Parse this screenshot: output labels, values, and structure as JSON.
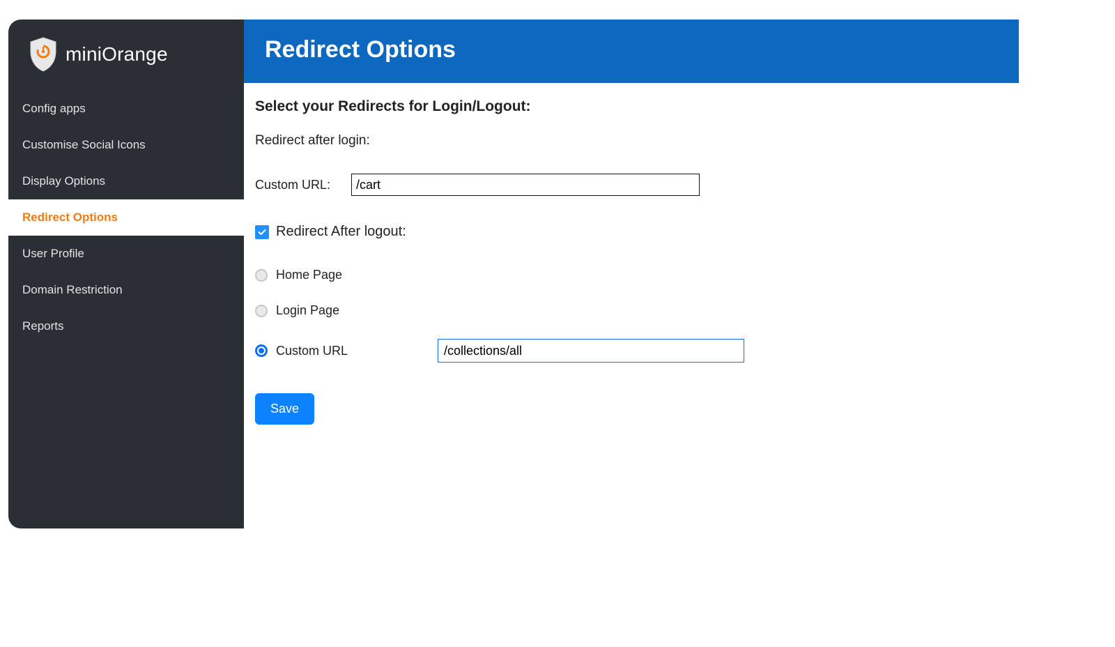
{
  "brand": {
    "name": "miniOrange"
  },
  "sidebar": {
    "items": [
      {
        "label": "Config apps",
        "active": false
      },
      {
        "label": "Customise Social Icons",
        "active": false
      },
      {
        "label": "Display Options",
        "active": false
      },
      {
        "label": "Redirect Options",
        "active": true
      },
      {
        "label": "User Profile",
        "active": false
      },
      {
        "label": "Domain Restriction",
        "active": false
      },
      {
        "label": "Reports",
        "active": false
      }
    ]
  },
  "header": {
    "title": "Redirect Options"
  },
  "form": {
    "section_title": "Select your Redirects for Login/Logout:",
    "login_redirect_label": "Redirect after login:",
    "custom_url_label": "Custom URL:",
    "custom_url_value": "/cart",
    "logout_checkbox_label": "Redirect After logout:",
    "logout_checkbox_checked": true,
    "radios": {
      "home": "Home Page",
      "login": "Login Page",
      "custom": "Custom URL",
      "selected": "custom"
    },
    "logout_custom_url_value": "/collections/all",
    "save_label": "Save"
  },
  "colors": {
    "brand_orange": "#f27b13",
    "hero_blue": "#0c69bf",
    "primary_blue": "#0d6efd",
    "button_blue": "#0d82ff",
    "sidebar_bg": "#2a2f35"
  }
}
